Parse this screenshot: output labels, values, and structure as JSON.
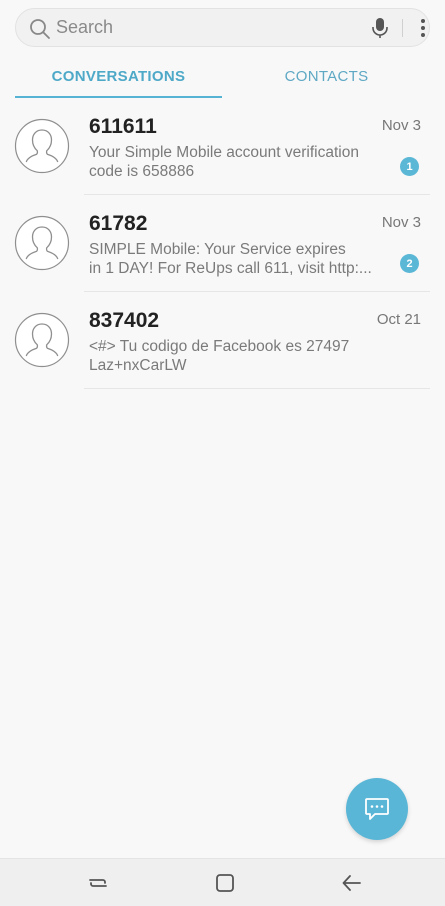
{
  "search": {
    "placeholder": "Search"
  },
  "tabs": [
    {
      "label": "CONVERSATIONS",
      "active": true
    },
    {
      "label": "CONTACTS",
      "active": false
    }
  ],
  "conversations": [
    {
      "name": "611611",
      "preview_line1": "Your Simple Mobile account verification",
      "preview_line2": "code is 658886",
      "date": "Nov 3",
      "unread": "1"
    },
    {
      "name": "61782",
      "preview_line1": "SIMPLE Mobile: Your Service expires",
      "preview_line2": "in 1 DAY! For ReUps call 611, visit http:...",
      "date": "Nov 3",
      "unread": "2"
    },
    {
      "name": "837402",
      "preview_line1": "<#> Tu codigo de Facebook es 27497",
      "preview_line2": "Laz+nxCarLW",
      "date": "Oct 21",
      "unread": ""
    }
  ],
  "icons": {
    "search": "search-icon",
    "mic": "mic-icon",
    "more": "more-vertical-icon",
    "avatar": "person-avatar-icon",
    "compose": "chat-bubble-icon",
    "nav_recent": "recent-apps-icon",
    "nav_home": "home-icon",
    "nav_back": "back-arrow-icon"
  },
  "colors": {
    "accent": "#56b3d3",
    "badge": "#5bb7d6",
    "fab": "#5ab6d6",
    "background": "#f8f8f8"
  }
}
